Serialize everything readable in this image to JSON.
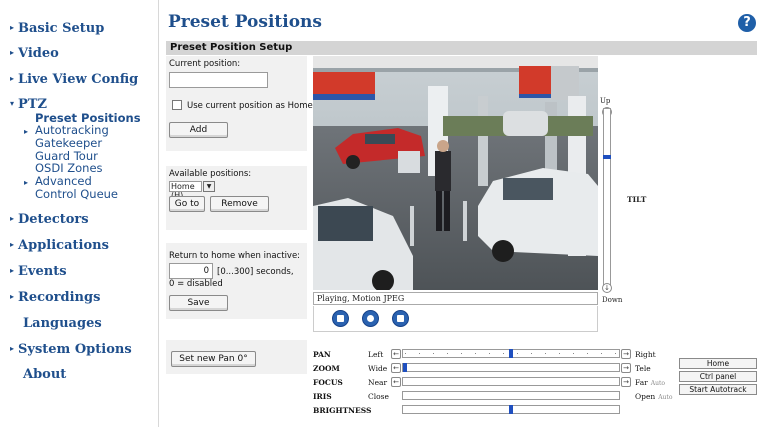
{
  "sidebar": {
    "items": [
      {
        "label": "Basic Setup"
      },
      {
        "label": "Video"
      },
      {
        "label": "Live View Config"
      },
      {
        "label": "PTZ"
      },
      {
        "label": "Detectors"
      },
      {
        "label": "Applications"
      },
      {
        "label": "Events"
      },
      {
        "label": "Recordings"
      },
      {
        "label": "Languages"
      },
      {
        "label": "System Options"
      },
      {
        "label": "About"
      }
    ],
    "ptz_sub": [
      {
        "label": "Preset Positions"
      },
      {
        "label": "Autotracking"
      },
      {
        "label": "Gatekeeper"
      },
      {
        "label": "Guard Tour"
      },
      {
        "label": "OSDI Zones"
      },
      {
        "label": "Advanced"
      },
      {
        "label": "Control Queue"
      }
    ]
  },
  "header": {
    "title": "Preset Positions",
    "help_glyph": "?"
  },
  "section": {
    "title": "Preset Position Setup"
  },
  "form": {
    "current_position_label": "Current position:",
    "current_position_value": "",
    "use_home_label": "Use current position as Home",
    "use_home_checked": false,
    "add_label": "Add",
    "available_label": "Available positions:",
    "available_selected": "Home (H)",
    "goto_label": "Go to",
    "remove_label": "Remove",
    "return_label": "Return to home when inactive:",
    "return_value": "0",
    "return_range": "[0...300] seconds,",
    "return_note": "0 = disabled",
    "save_label": "Save",
    "set_pan_label": "Set new Pan 0°"
  },
  "video": {
    "status": "Playing, Motion JPEG"
  },
  "tilt": {
    "up_label": "Up",
    "down_label": "Down",
    "title": "TILT",
    "level": 0.27
  },
  "controls": [
    {
      "name": "PAN",
      "left": "Left",
      "right": "Right",
      "auto": "",
      "value": 0.5
    },
    {
      "name": "ZOOM",
      "left": "Wide",
      "right": "Tele",
      "auto": "",
      "value": 0.0
    },
    {
      "name": "FOCUS",
      "left": "Near",
      "right": "Far",
      "auto": "Auto",
      "value": null
    },
    {
      "name": "IRIS",
      "left": "Close",
      "right": "Open",
      "auto": "Auto",
      "value": null
    },
    {
      "name": "BRIGHTNESS",
      "left": "",
      "right": "",
      "auto": "",
      "value": 0.5
    }
  ],
  "right_buttons": {
    "home": "Home",
    "ctrl_panel": "Ctrl panel",
    "start_autotrack": "Start Autotrack"
  },
  "colors": {
    "nav": "#1f4f8c",
    "thumb": "#1f4fbf",
    "header_bar": "#d4d4d4"
  }
}
